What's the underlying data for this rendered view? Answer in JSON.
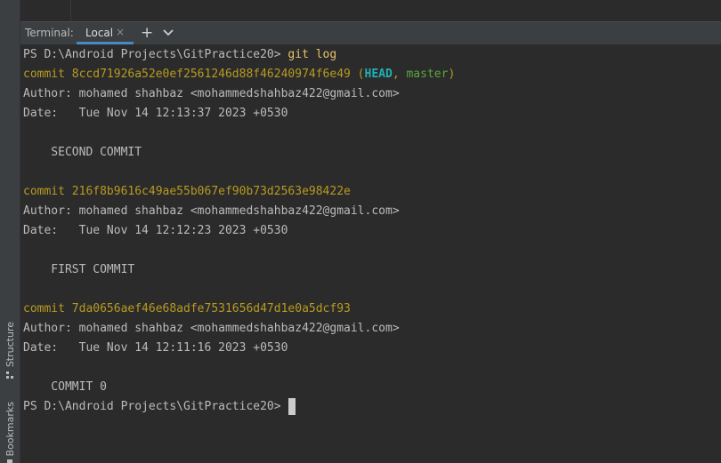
{
  "side_tools": {
    "structure_label": "Structure",
    "bookmarks_label": "Bookmarks"
  },
  "tab_bar": {
    "terminal_label": "Terminal:",
    "tab_label": "Local",
    "close_glyph": "×",
    "add_glyph": "+",
    "dropdown_icon": "chevron-down-icon"
  },
  "terminal": {
    "prompt": "PS D:\\Android Projects\\GitPractice20>",
    "command": "git log",
    "commits": [
      {
        "hash_line": "commit 8ccd71926a52e0ef2561246d88f46240974f6e49",
        "refs_open": " (",
        "head": "HEAD",
        "refs_sep": ", ",
        "branch": "master",
        "refs_close": ")",
        "author": "Author: mohamed shahbaz <mohammedshahbaz422@gmail.com>",
        "date": "Date:   Tue Nov 14 12:13:37 2023 +0530",
        "message": "    SECOND COMMIT"
      },
      {
        "hash_line": "commit 216f8b9616c49ae55b067ef90b73d2563e98422e",
        "author": "Author: mohamed shahbaz <mohammedshahbaz422@gmail.com>",
        "date": "Date:   Tue Nov 14 12:12:23 2023 +0530",
        "message": "    FIRST COMMIT"
      },
      {
        "hash_line": "commit 7da0656aef46e68adfe7531656d47d1e0a5dcf93",
        "author": "Author: mohamed shahbaz <mohammedshahbaz422@gmail.com>",
        "date": "Date:   Tue Nov 14 12:11:16 2023 +0530",
        "message": "    COMMIT 0"
      }
    ],
    "final_prompt": "PS D:\\Android Projects\\GitPractice20>"
  },
  "colors": {
    "background": "#2b2b2b",
    "commit_hash": "#b89a20",
    "command": "#e6c26a",
    "head_ref": "#1fb0b4",
    "branch_ref": "#5aa83c",
    "tab_underline": "#4a88c7"
  }
}
